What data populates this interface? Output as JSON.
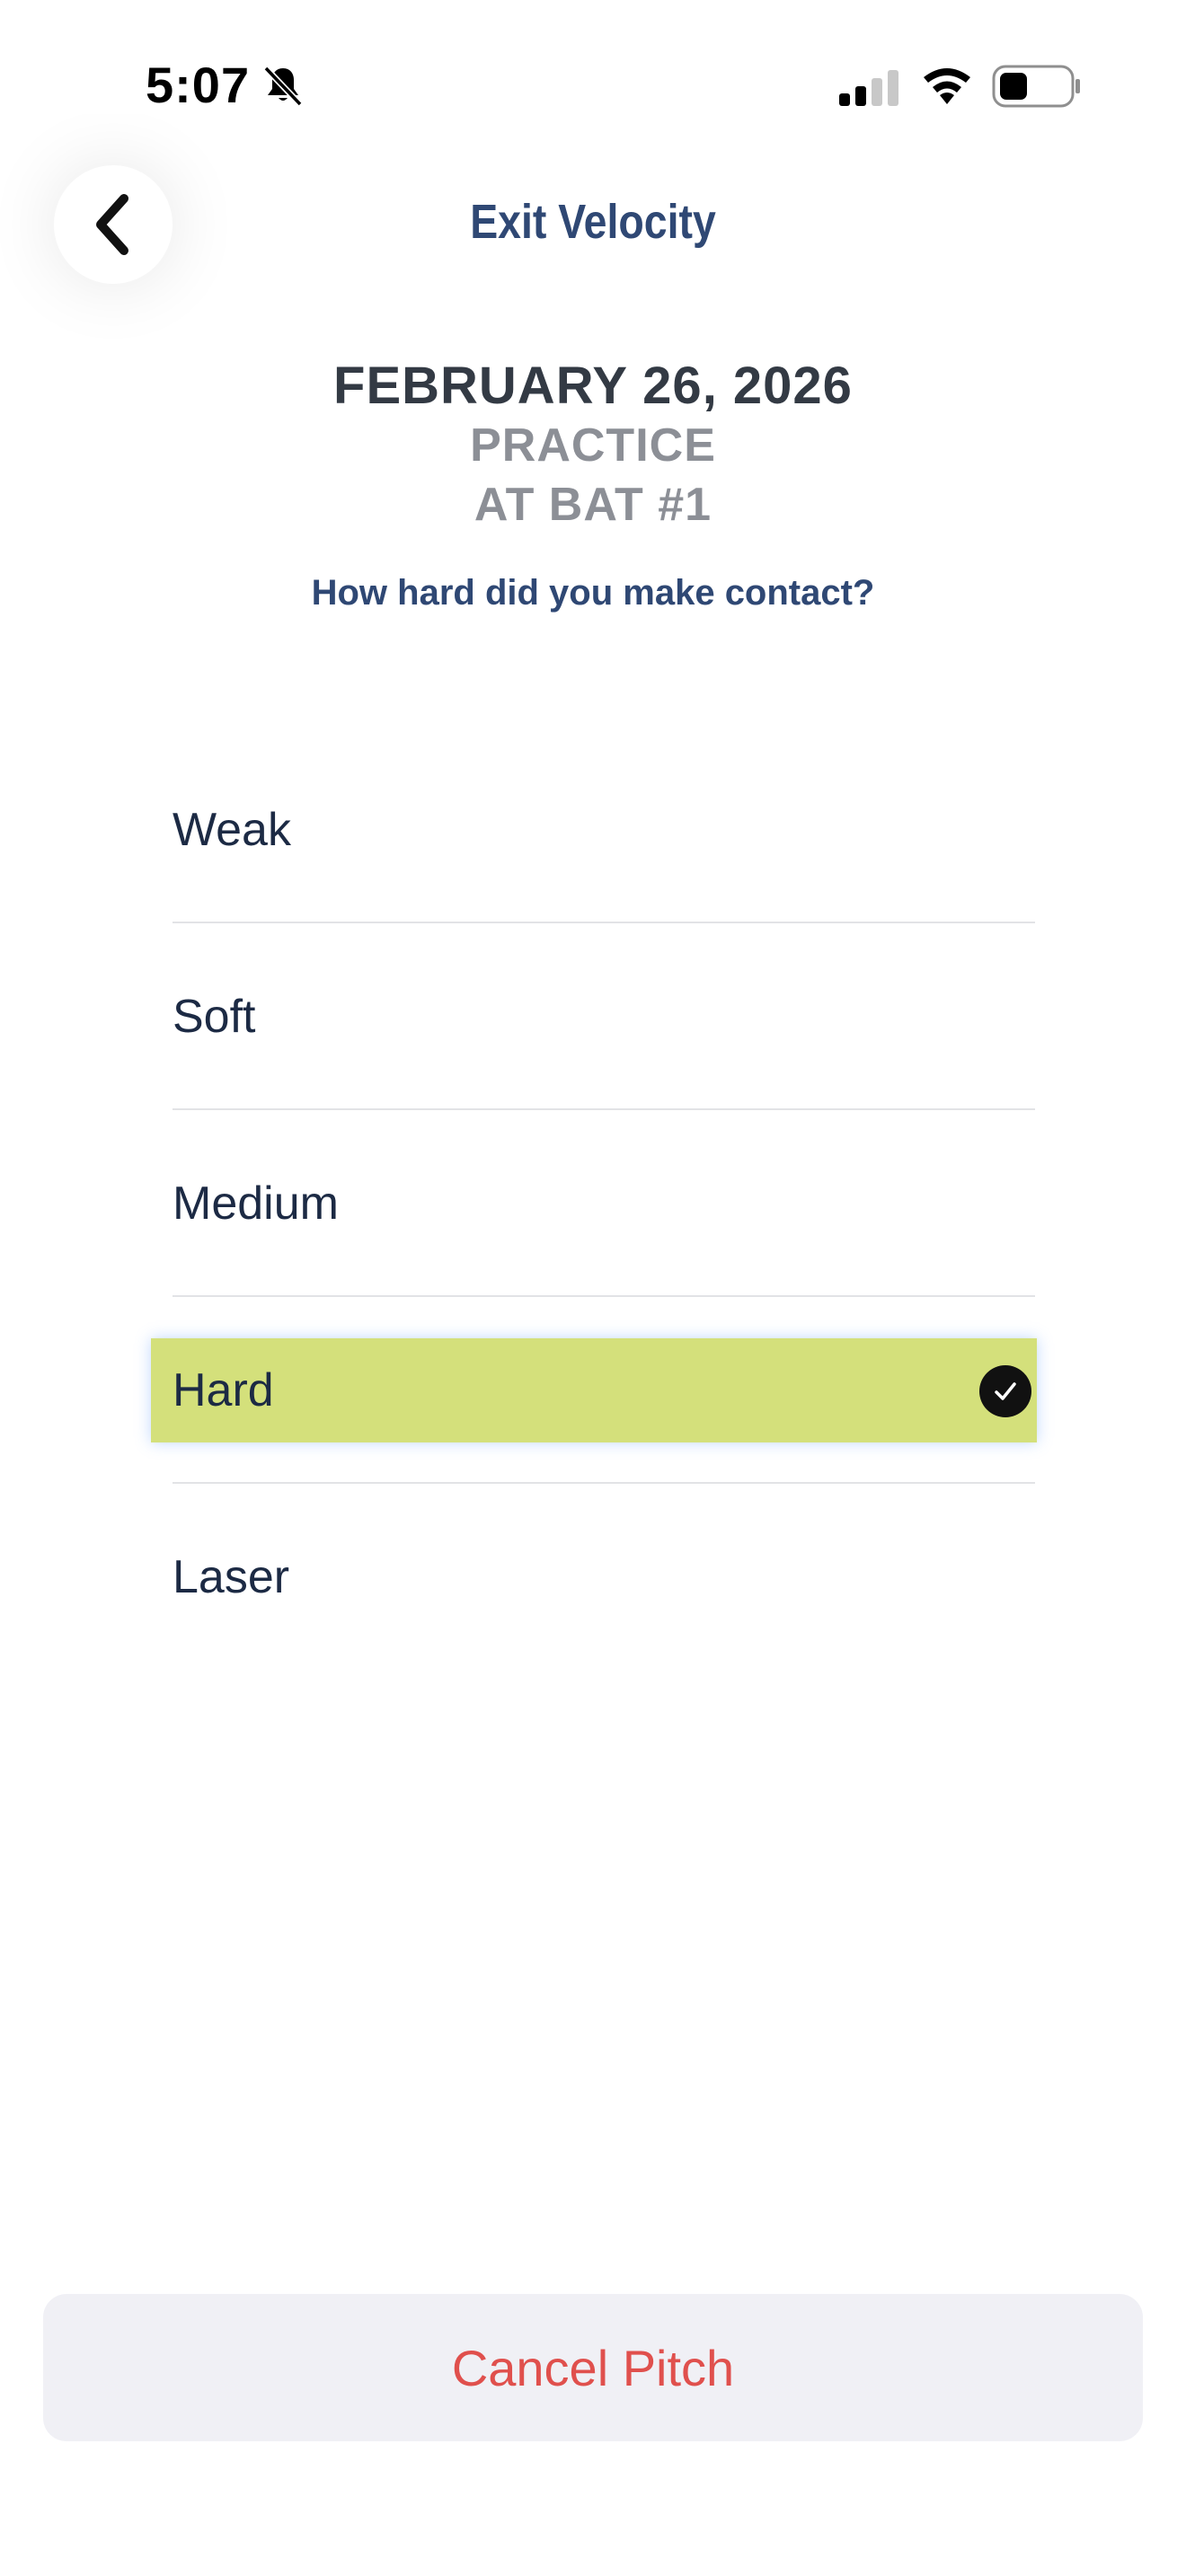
{
  "status_bar": {
    "time": "5:07",
    "icons": [
      "bell-slash-icon",
      "cellular-signal-icon",
      "wifi-icon",
      "battery-icon"
    ]
  },
  "header": {
    "back_icon": "chevron-left-icon",
    "title": "Exit Velocity"
  },
  "summary": {
    "date": "FEBRUARY 26, 2026",
    "session": "PRACTICE",
    "at_bat": "AT BAT #1",
    "question": "How hard did you make contact?"
  },
  "options": [
    {
      "label": "Weak",
      "selected": false
    },
    {
      "label": "Soft",
      "selected": false
    },
    {
      "label": "Medium",
      "selected": false
    },
    {
      "label": "Hard",
      "selected": true
    },
    {
      "label": "Laser",
      "selected": false
    }
  ],
  "footer": {
    "cancel_label": "Cancel Pitch"
  },
  "colors": {
    "accent_navy": "#2f4874",
    "selected_highlight": "#d4e07b",
    "cancel_red": "#e0504d"
  }
}
